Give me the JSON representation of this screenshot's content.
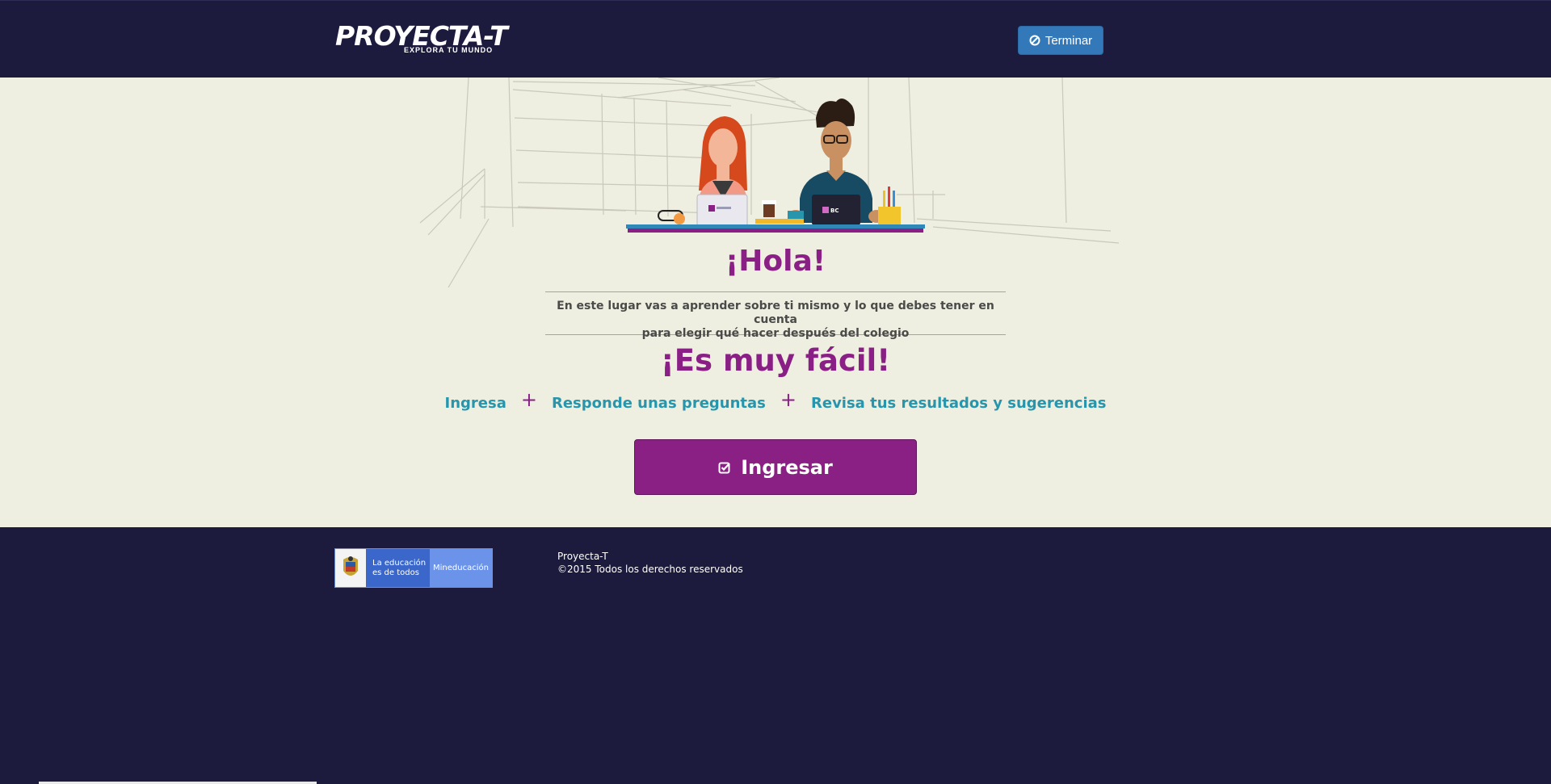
{
  "header": {
    "logo_main": "PROYECTA-T",
    "logo_sub": "EXPLORA TU MUNDO",
    "terminar_label": "Terminar",
    "terminar_icon": "ban-icon"
  },
  "main": {
    "greeting": "¡Hola!",
    "description_line1": "En este lugar vas a aprender sobre ti mismo y lo que debes tener en cuenta",
    "description_line2": "para elegir qué hacer después del colegio",
    "easy_title": "¡Es muy fácil!",
    "steps": [
      "Ingresa",
      "Responde unas preguntas",
      "Revisa tus resultados y sugerencias"
    ],
    "plus_sign": "+",
    "ingresar_label": "Ingresar",
    "ingresar_icon": "check-square-icon",
    "laptop_label_right": "BC"
  },
  "footer": {
    "logo_text_line1": "La educación",
    "logo_text_line2": "es de todos",
    "logo_text_right": "Mineducación",
    "site_name": "Proyecta-T",
    "copyright": "©2015 Todos los derechos reservados"
  },
  "colors": {
    "navy": "#1c1b3d",
    "cream": "#efefe1",
    "purple": "#8a2085",
    "teal": "#2796ad",
    "blue_button": "#3378b9"
  }
}
